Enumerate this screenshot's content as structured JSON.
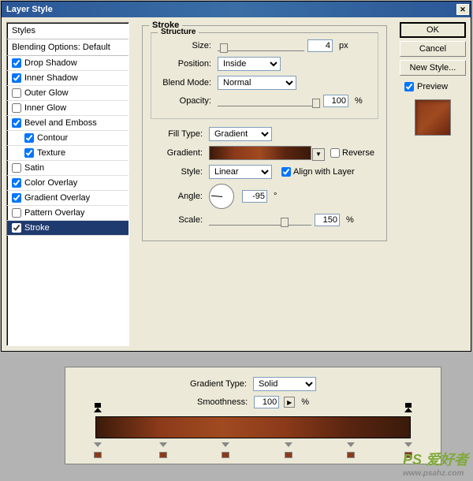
{
  "title": "Layer Style",
  "styles_header": "Styles",
  "blending_options": "Blending Options: Default",
  "style_items": [
    {
      "label": "Drop Shadow",
      "checked": true
    },
    {
      "label": "Inner Shadow",
      "checked": true
    },
    {
      "label": "Outer Glow",
      "checked": false
    },
    {
      "label": "Inner Glow",
      "checked": false
    },
    {
      "label": "Bevel and Emboss",
      "checked": true
    },
    {
      "label": "Contour",
      "checked": true,
      "indent": true
    },
    {
      "label": "Texture",
      "checked": true,
      "indent": true
    },
    {
      "label": "Satin",
      "checked": false
    },
    {
      "label": "Color Overlay",
      "checked": true
    },
    {
      "label": "Gradient Overlay",
      "checked": true
    },
    {
      "label": "Pattern Overlay",
      "checked": false
    },
    {
      "label": "Stroke",
      "checked": true,
      "selected": true
    }
  ],
  "panel": {
    "title": "Stroke",
    "structure_title": "Structure",
    "size_label": "Size:",
    "size_value": "4",
    "px": "px",
    "position_label": "Position:",
    "position_value": "Inside",
    "blendmode_label": "Blend Mode:",
    "blendmode_value": "Normal",
    "opacity_label": "Opacity:",
    "opacity_value": "100",
    "pct": "%",
    "filltype_label": "Fill Type:",
    "filltype_value": "Gradient",
    "gradient_label": "Gradient:",
    "reverse_label": "Reverse",
    "style_label": "Style:",
    "style_value": "Linear",
    "align_label": "Align with Layer",
    "angle_label": "Angle:",
    "angle_value": "-95",
    "deg": "°",
    "scale_label": "Scale:",
    "scale_value": "150"
  },
  "buttons": {
    "ok": "OK",
    "cancel": "Cancel",
    "new_style": "New Style...",
    "preview": "Preview"
  },
  "grad_editor": {
    "type_label": "Gradient Type:",
    "type_value": "Solid",
    "smooth_label": "Smoothness:",
    "smooth_value": "100",
    "pct": "%"
  },
  "watermark": {
    "main": "PS 爱好者",
    "sub": "www.psahz.com"
  }
}
